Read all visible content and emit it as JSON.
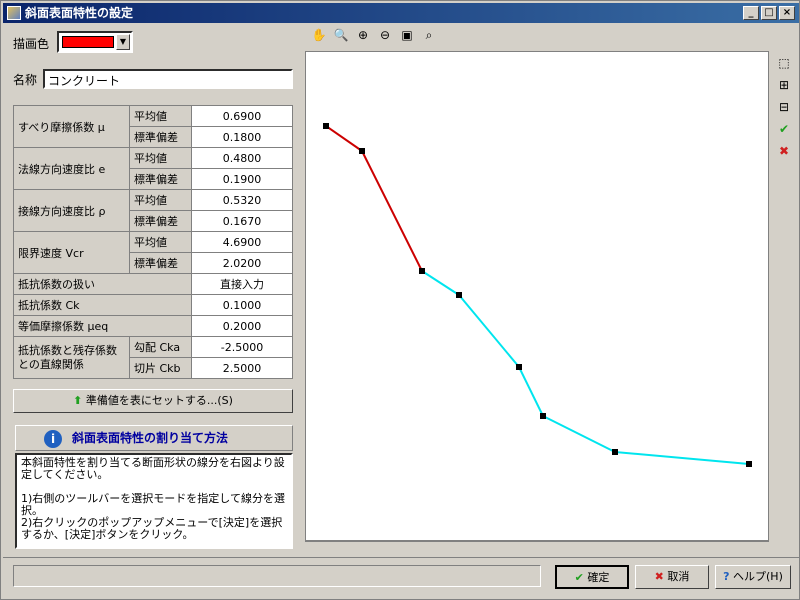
{
  "window": {
    "title": "斜面表面特性の設定"
  },
  "draw_color": {
    "label": "描画色",
    "value": "#ff0000"
  },
  "name": {
    "label": "名称",
    "value": "コンクリート"
  },
  "table": {
    "rows": [
      {
        "label": "すべり摩擦係数 μ",
        "sub": "平均値",
        "value": "0.6900"
      },
      {
        "label": "",
        "sub": "標準偏差",
        "value": "0.1800"
      },
      {
        "label": "法線方向速度比 e",
        "sub": "平均値",
        "value": "0.4800"
      },
      {
        "label": "",
        "sub": "標準偏差",
        "value": "0.1900"
      },
      {
        "label": "接線方向速度比 ρ",
        "sub": "平均値",
        "value": "0.5320"
      },
      {
        "label": "",
        "sub": "標準偏差",
        "value": "0.1670"
      },
      {
        "label": "限界速度 Vcr",
        "sub": "平均値",
        "value": "4.6900"
      },
      {
        "label": "",
        "sub": "標準偏差",
        "value": "2.0200"
      }
    ],
    "r_handling": {
      "label": "抵抗係数の扱い",
      "value": "直接入力"
    },
    "r_ck": {
      "label": "抵抗係数 Ck",
      "value": "0.1000"
    },
    "r_meq": {
      "label": "等価摩擦係数 μeq",
      "value": "0.2000"
    },
    "r_lin_label": "抵抗係数と残存係数との直線関係",
    "r_cka": {
      "sub": "勾配 Cka",
      "value": "-2.5000"
    },
    "r_ckb": {
      "sub": "切片 Ckb",
      "value": "2.5000"
    }
  },
  "set_button": "準備値を表にセットする...(S)",
  "info": {
    "title": "斜面表面特性の割り当て方法",
    "text": "本斜面特性を割り当てる断面形状の線分を右図より設定してください。\n\n1)右側のツールバーを選択モードを指定して線分を選択。\n2)右クリックのポップアップメニューで[決定]を選択するか、[決定]ボタンをクリック。"
  },
  "buttons": {
    "ok": "確定",
    "cancel": "取消",
    "help": "ヘルプ(H)"
  },
  "colors": {
    "assigned": "#cc0000",
    "unassigned": "#00e5ee"
  }
}
